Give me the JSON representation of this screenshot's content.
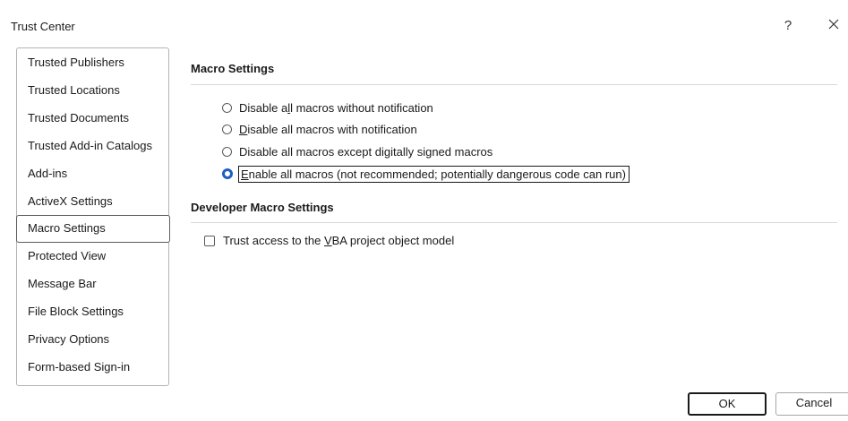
{
  "window": {
    "title": "Trust Center",
    "help_label": "?"
  },
  "nav": {
    "items": [
      {
        "label": "Trusted Publishers"
      },
      {
        "label": "Trusted Locations"
      },
      {
        "label": "Trusted Documents"
      },
      {
        "label": "Trusted Add-in Catalogs"
      },
      {
        "label": "Add-ins"
      },
      {
        "label": "ActiveX Settings"
      },
      {
        "label": "Macro Settings",
        "selected": true
      },
      {
        "label": "Protected View"
      },
      {
        "label": "Message Bar"
      },
      {
        "label": "File Block Settings"
      },
      {
        "label": "Privacy Options"
      },
      {
        "label": "Form-based Sign-in"
      }
    ]
  },
  "macro_settings": {
    "heading": "Macro Settings",
    "options": [
      {
        "pre": "Disable a",
        "accel": "l",
        "post": "l macros without notification",
        "selected": false
      },
      {
        "pre": "",
        "accel": "D",
        "post": "isable all macros with notification",
        "selected": false
      },
      {
        "pre": "Disable all macros except di",
        "accel": "g",
        "post": "itally signed macros",
        "selected": false
      },
      {
        "pre": "",
        "accel": "E",
        "post": "nable all macros (not recommended; potentially dangerous code can run)",
        "selected": true
      }
    ]
  },
  "developer": {
    "heading": "Developer Macro Settings",
    "vba_pre": "Trust access to the ",
    "vba_accel": "V",
    "vba_post": "BA project object model",
    "vba_checked": false
  },
  "buttons": {
    "ok": "OK",
    "cancel": "Cancel"
  },
  "colors": {
    "accent": "#1f5fbf"
  }
}
